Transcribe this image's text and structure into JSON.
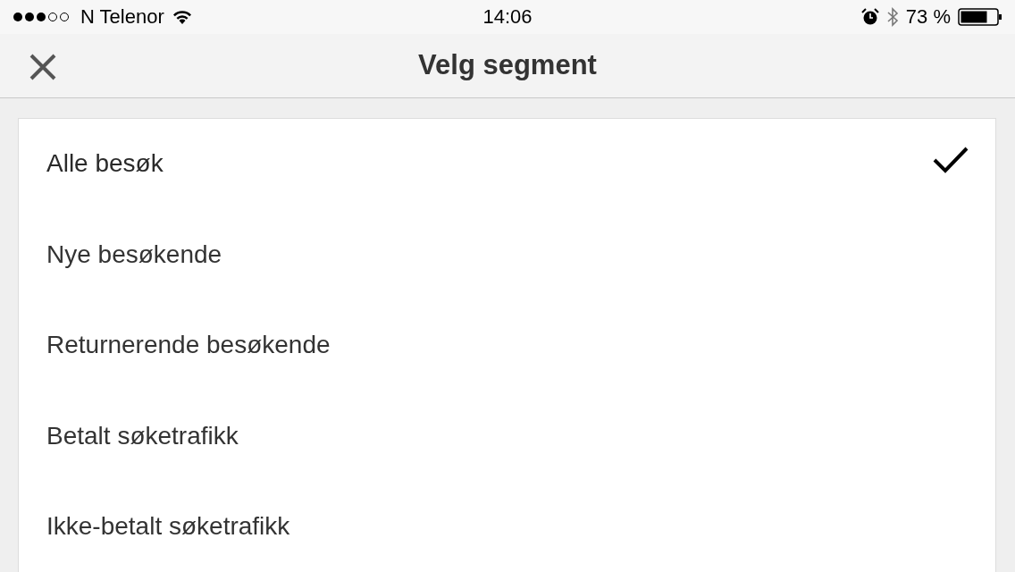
{
  "status_bar": {
    "carrier": "N Telenor",
    "time": "14:06",
    "battery": "73 %"
  },
  "nav": {
    "title": "Velg segment"
  },
  "segments": [
    {
      "label": "Alle besøk",
      "selected": true
    },
    {
      "label": "Nye besøkende",
      "selected": false
    },
    {
      "label": "Returnerende besøkende",
      "selected": false
    },
    {
      "label": "Betalt søketrafikk",
      "selected": false
    },
    {
      "label": "Ikke-betalt søketrafikk",
      "selected": false
    }
  ]
}
